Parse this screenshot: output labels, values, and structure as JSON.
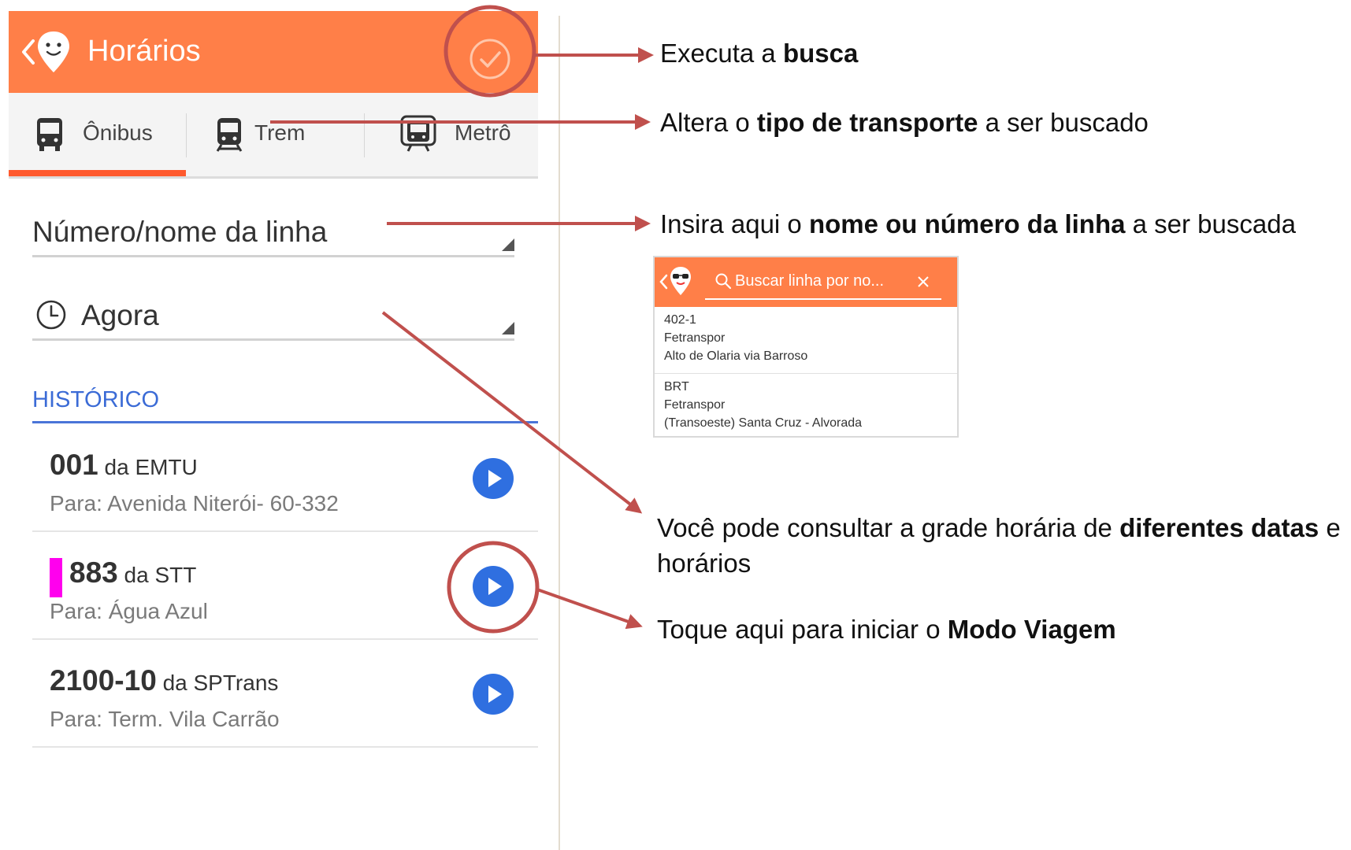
{
  "app": {
    "title": "Horários"
  },
  "tabs": [
    {
      "label": "Ônibus",
      "icon": "bus-icon",
      "selected": true
    },
    {
      "label": "Trem",
      "icon": "train-icon",
      "selected": false
    },
    {
      "label": "Metrô",
      "icon": "subway-icon",
      "selected": false
    }
  ],
  "line_field": {
    "placeholder": "Número/nome da linha"
  },
  "time_field": {
    "value": "Agora",
    "icon": "clock-icon"
  },
  "history": {
    "title": "HISTÓRICO",
    "items": [
      {
        "line": "001",
        "operator": "da EMTU",
        "destination": "Para: Avenida Niterói- 60-332",
        "color_bar": null
      },
      {
        "line": "883",
        "operator": "da STT",
        "destination": "Para: Água Azul",
        "color_bar": "#ff00ee"
      },
      {
        "line": "2100-10",
        "operator": "da SPTrans",
        "destination": "Para: Term. Vila Carrão",
        "color_bar": null
      }
    ]
  },
  "annotations": {
    "search": {
      "pre": "Executa a ",
      "bold": "busca",
      "post": ""
    },
    "transport": {
      "pre": "Altera o ",
      "bold": "tipo de transporte",
      "post": " a ser buscado"
    },
    "line": {
      "pre": "Insira aqui o ",
      "bold": "nome ou número da linha",
      "post": " a ser buscada"
    },
    "dates": {
      "pre": "Você pode consultar a grade horária de ",
      "bold": "diferentes datas",
      "post": " e",
      "line2": "horários"
    },
    "trip": {
      "pre": "Toque aqui para iniciar o ",
      "bold": "Modo Viagem",
      "post": ""
    }
  },
  "inset": {
    "search_placeholder": "Buscar linha por no...",
    "results": [
      {
        "line1": "402-1",
        "line2": "Fetranspor",
        "line3": "Alto de Olaria via Barroso"
      },
      {
        "line1": "BRT",
        "line2": "Fetranspor",
        "line3": "(Transoeste) Santa Cruz - Alvorada"
      }
    ]
  },
  "colors": {
    "appbar": "#ff7f48",
    "tab_indicator": "#ff5a2e",
    "history_accent": "#3b6bd6",
    "play_button": "#2f6fe0",
    "annotation_arrow": "#c0504d"
  }
}
